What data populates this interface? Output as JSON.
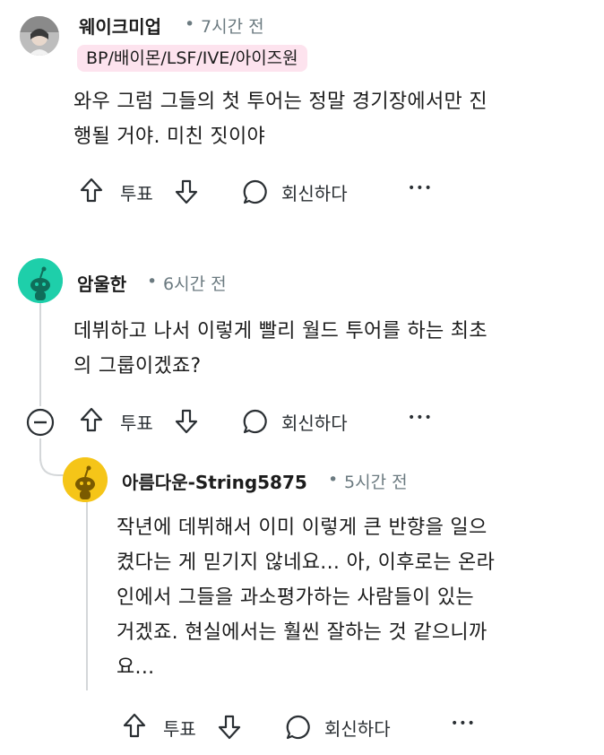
{
  "comments": [
    {
      "username": "웨이크미업",
      "time": "7시간 전",
      "flair": "BP/배이몬/LSF/IVE/아이즈원",
      "text_lines": [
        "와우 그럼 그들의 첫 투어는 정말 경기장에서만 진",
        "행될 거야. 미친 짓이야"
      ],
      "vote_label": "투표",
      "reply_label": "회신하다",
      "more_label": "•••"
    },
    {
      "username": "암울한",
      "time": "6시간 전",
      "text_lines": [
        "데뷔하고 나서 이렇게 빨리 월드 투어를 하는 최초",
        "의 그룹이겠죠?"
      ],
      "vote_label": "투표",
      "reply_label": "회신하다",
      "more_label": "•••"
    },
    {
      "username": "아름다운-String5875",
      "time": "5시간 전",
      "text_lines": [
        "작년에 데뷔해서 이미 이렇게 큰 반향을 일으",
        "켰다는 게 믿기지 않네요... 아, 이후로는 온라",
        "인에서 그들을 과소평가하는 사람들이 있는",
        "거겠죠. 현실에서는 훨씬 잘하는 것 같으니까",
        "요..."
      ],
      "vote_label": "투표",
      "reply_label": "회신하다",
      "more_label": "•••"
    }
  ],
  "meta_separator": "•",
  "colors": {
    "flair_bg": "#fde3ee",
    "avatar_teal": "#1ecfaa",
    "avatar_yellow": "#f5c518",
    "thread_line": "#d4d7d9"
  },
  "icons": [
    "upvote-icon",
    "downvote-icon",
    "reply-bubble-icon",
    "collapse-minus-icon",
    "snoo-avatar-icon"
  ]
}
